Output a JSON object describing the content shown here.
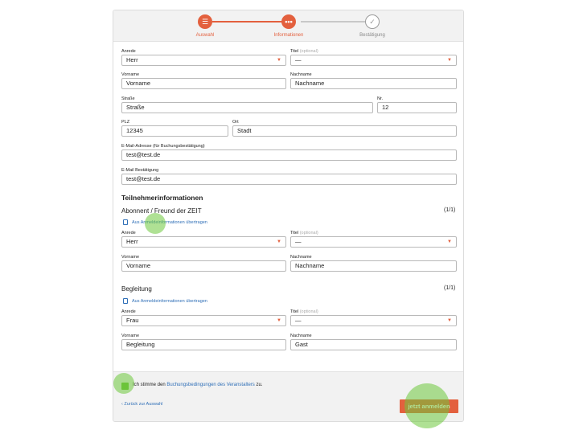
{
  "steps": [
    {
      "label": "Auswahl",
      "icon": "list-icon"
    },
    {
      "label": "Informationen",
      "icon": "info-icon"
    },
    {
      "label": "Bestätigung",
      "icon": "check-icon"
    }
  ],
  "booking": {
    "anrede_label": "Anrede",
    "anrede_value": "Herr",
    "titel_label": "Titel",
    "titel_optional": "(optional)",
    "titel_value": "—",
    "vorname_label": "Vorname",
    "vorname_value": "Vorname",
    "nachname_label": "Nachname",
    "nachname_value": "Nachname",
    "strasse_label": "Straße",
    "strasse_value": "Straße",
    "nr_label": "Nr.",
    "nr_value": "12",
    "plz_label": "PLZ",
    "plz_value": "12345",
    "ort_label": "Ort",
    "ort_value": "Stadt",
    "email_label": "E-Mail-Adresse (für Buchungsbestätigung)",
    "email_value": "test@test.de",
    "email_confirm_label": "E-Mail Bestätigung",
    "email_confirm_value": "test@test.de"
  },
  "participants": {
    "heading": "Teilnehmerinformationen",
    "p1": {
      "title": "Abonnent / Freund der ZEIT",
      "count": "(1/1)",
      "copy_link": "Aus Anmeldeinformationen übertragen",
      "anrede_label": "Anrede",
      "anrede_value": "Herr",
      "titel_label": "Titel",
      "titel_optional": "(optional)",
      "titel_value": "—",
      "vorname_label": "Vorname",
      "vorname_value": "Vorname",
      "nachname_label": "Nachname",
      "nachname_value": "Nachname"
    },
    "p2": {
      "title": "Begleitung",
      "count": "(1/1)",
      "copy_link": "Aus Anmeldeinformationen übertragen",
      "anrede_label": "Anrede",
      "anrede_value": "Frau",
      "titel_label": "Titel",
      "titel_optional": "(optional)",
      "titel_value": "—",
      "vorname_label": "Vorname",
      "vorname_value": "Begleitung",
      "nachname_label": "Nachname",
      "nachname_value": "Gast"
    }
  },
  "footer": {
    "agree_pre": "Ich stimme den",
    "agree_link": "Buchungsbedingungen des Veranstalters",
    "agree_post": "zu.",
    "back_link": "‹ Zurück zur Auswahl",
    "submit_label": "jetzt anmelden",
    "terms_checked": true
  },
  "colors": {
    "accent": "#e3603e",
    "link": "#2f6fb7",
    "tap": "#6ec83c"
  }
}
